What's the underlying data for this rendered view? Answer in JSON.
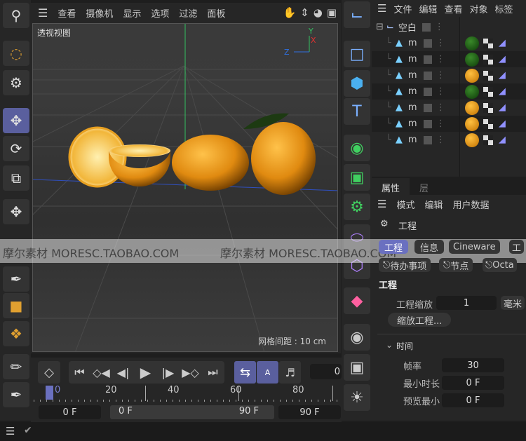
{
  "viewport": {
    "menu": [
      "查看",
      "摄像机",
      "显示",
      "选项",
      "过滤",
      "面板"
    ],
    "view_label": "透视视图",
    "grid_spacing": "网格间距 : 10 cm",
    "axis": {
      "y": "Y",
      "x": "X",
      "z": "Z"
    }
  },
  "object_manager": {
    "menu": [
      "文件",
      "编辑",
      "查看",
      "对象",
      "标签"
    ],
    "root": "空白",
    "children": [
      {
        "name": "m",
        "material": "green"
      },
      {
        "name": "m",
        "material": "green"
      },
      {
        "name": "m",
        "material": "orange"
      },
      {
        "name": "m",
        "material": "green"
      },
      {
        "name": "m",
        "material": "orange"
      },
      {
        "name": "m",
        "material": "orange"
      },
      {
        "name": "m",
        "material": "orange"
      }
    ]
  },
  "attributes": {
    "tabs": [
      "属性",
      "层"
    ],
    "menu": [
      "模式",
      "编辑",
      "用户数据"
    ],
    "object": "工程",
    "chips_row1": [
      "工程",
      "信息",
      "Cineware",
      "工"
    ],
    "chips_row2": [
      "待办事项",
      "节点",
      "Octa"
    ],
    "section": "工程",
    "scale_label": "工程缩放",
    "scale_value": "1",
    "scale_unit": "毫米",
    "scale_button": "缩放工程...",
    "time_section": "时间",
    "fps_label": "帧率",
    "fps_value": "30",
    "min_label": "最小时长",
    "min_value": "0 F",
    "preview_label": "预览最小",
    "preview_value": "0 F"
  },
  "timeline": {
    "current_frame": "0",
    "ruler": [
      "0",
      "20",
      "40",
      "60",
      "80"
    ],
    "start": "0 F",
    "range_start": "0 F",
    "range_end": "90 F",
    "end": "90 F"
  },
  "watermark": "摩尔素材 MORESC.TAOBAO.COM",
  "colors": {
    "accent": "#5a5f9e",
    "green_axis": "#33c060"
  }
}
